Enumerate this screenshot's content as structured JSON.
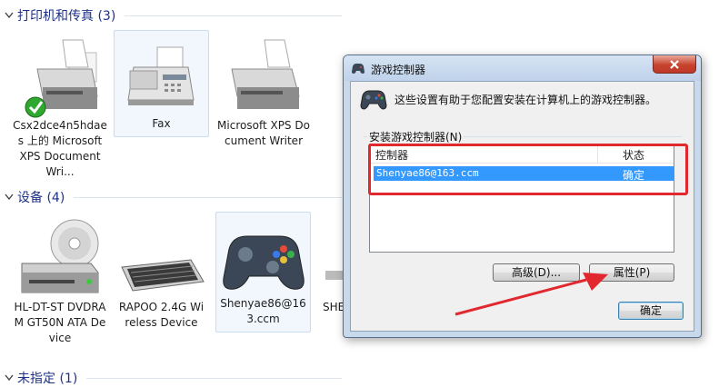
{
  "groups": [
    {
      "title": "打印机和传真 (3)"
    },
    {
      "title": "设备 (4)"
    },
    {
      "title": "未指定 (1)"
    }
  ],
  "printers": [
    {
      "label": "Csx2dce4n5hdaes 上的 Microsoft XPS Document Wri...",
      "icon": "printer-default-icon"
    },
    {
      "label": "Fax",
      "icon": "fax-icon"
    },
    {
      "label": "Microsoft XPS Document Writer",
      "icon": "printer-icon"
    }
  ],
  "devices": [
    {
      "label": "HL-DT-ST DVDRAM GT50N ATA Device",
      "icon": "dvd-drive-icon"
    },
    {
      "label": "RAPOO 2.4G Wireless Device",
      "icon": "keyboard-icon"
    },
    {
      "label": "Shenyae86@163.ccm",
      "icon": "gamepad-icon"
    },
    {
      "label": "SHE",
      "icon": "device-icon"
    }
  ],
  "dialog": {
    "title": "游戏控制器",
    "intro": "这些设置有助于您配置安装在计算机上的游戏控制器。",
    "group_label": "安装游戏控制器(N)",
    "columns": [
      "控制器",
      "状态"
    ],
    "rows": [
      {
        "name": "Shenyae86@163.ccm",
        "status": "确定"
      }
    ],
    "advanced_label": "高级(D)...",
    "properties_label": "属性(P)",
    "ok_label": "确定"
  },
  "colors": {
    "group_title": "#1e3287",
    "selection": "#3399ff",
    "annotation": "#e0282e"
  }
}
